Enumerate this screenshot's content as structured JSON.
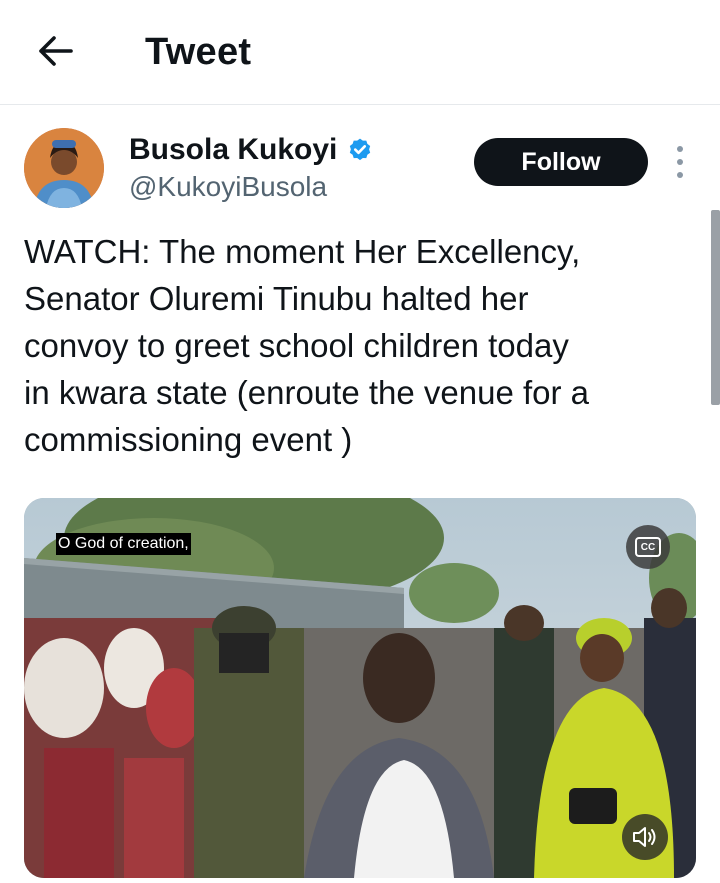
{
  "header": {
    "title": "Tweet",
    "back_icon": "arrow-left-icon"
  },
  "author": {
    "display_name": "Busola Kukoyi",
    "handle": "@KukoyiBusola",
    "verified": true,
    "follow_label": "Follow"
  },
  "tweet": {
    "text": "WATCH: The moment Her Excellency,\nSenator Oluremi Tinubu halted her\nconvoy to greet school children today\nin kwara state (enroute the venue for a\ncommissioning event )"
  },
  "media": {
    "type": "video",
    "caption": "O God of creation,",
    "cc_label": "CC",
    "muted": true
  },
  "colors": {
    "text_primary": "#0f1419",
    "text_secondary": "#536471",
    "follow_bg": "#0f1419",
    "verified_blue": "#1d9bf0"
  }
}
